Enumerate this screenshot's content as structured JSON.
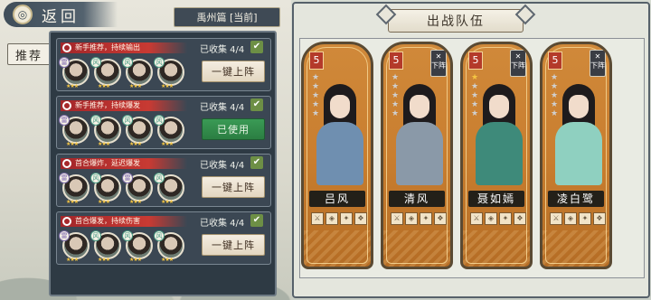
{
  "back": {
    "label": "返回"
  },
  "chapter": {
    "label": "禹州篇 [当前]"
  },
  "tabs": {
    "recommend": "推荐"
  },
  "presets": [
    {
      "tag": "新手推荐，持续输出",
      "collected": "已收集 4/4",
      "button": "一键上阵",
      "state": "available",
      "heroes": [
        {
          "elem": "雷",
          "stars": "★★★"
        },
        {
          "elem": "风",
          "stars": "★★★"
        },
        {
          "elem": "风",
          "stars": "★★★"
        },
        {
          "elem": "风",
          "stars": "★★★"
        }
      ]
    },
    {
      "tag": "新手推荐，持续爆发",
      "collected": "已收集 4/4",
      "button": "已使用",
      "state": "used",
      "heroes": [
        {
          "elem": "雷",
          "stars": "★★★"
        },
        {
          "elem": "风",
          "stars": "★★★"
        },
        {
          "elem": "风",
          "stars": "★★★"
        },
        {
          "elem": "风",
          "stars": "★★★"
        }
      ]
    },
    {
      "tag": "首合爆炸，延迟爆发",
      "collected": "已收集 4/4",
      "button": "一键上阵",
      "state": "available",
      "heroes": [
        {
          "elem": "雷",
          "stars": "★★★"
        },
        {
          "elem": "风",
          "stars": "★★★"
        },
        {
          "elem": "雷",
          "stars": "★★★"
        },
        {
          "elem": "风",
          "stars": "★★★"
        }
      ]
    },
    {
      "tag": "首合爆发，持续伤害",
      "collected": "已收集 4/4",
      "button": "一键上阵",
      "state": "available",
      "heroes": [
        {
          "elem": "雷",
          "stars": "★★★"
        },
        {
          "elem": "风",
          "stars": "★★★"
        },
        {
          "elem": "风",
          "stars": "★★★"
        },
        {
          "elem": "风",
          "stars": "★★★"
        }
      ]
    }
  ],
  "team": {
    "title": "出战队伍",
    "remove_label": "下阵",
    "members": [
      {
        "name": "吕风",
        "level": "5",
        "stars_on": 0,
        "outfit": "#6f8fb0",
        "removable": false
      },
      {
        "name": "清风",
        "level": "5",
        "stars_on": 0,
        "outfit": "#8a99a8",
        "removable": true
      },
      {
        "name": "聂如嫣",
        "level": "5",
        "stars_on": 1,
        "outfit": "#3e8a7a",
        "removable": true
      },
      {
        "name": "凌白鹭",
        "level": "5",
        "stars_on": 0,
        "outfit": "#8fd0c0",
        "removable": true
      }
    ]
  },
  "colors": {
    "accent_red": "#c83a33",
    "used_green": "#2b7e42",
    "card_orange": "#c97e2f",
    "star_gold": "#f4c542"
  },
  "icons": {
    "back": "swirl-icon",
    "check": "check-icon",
    "tag": "search-icon",
    "equip": "equipment-icon"
  }
}
